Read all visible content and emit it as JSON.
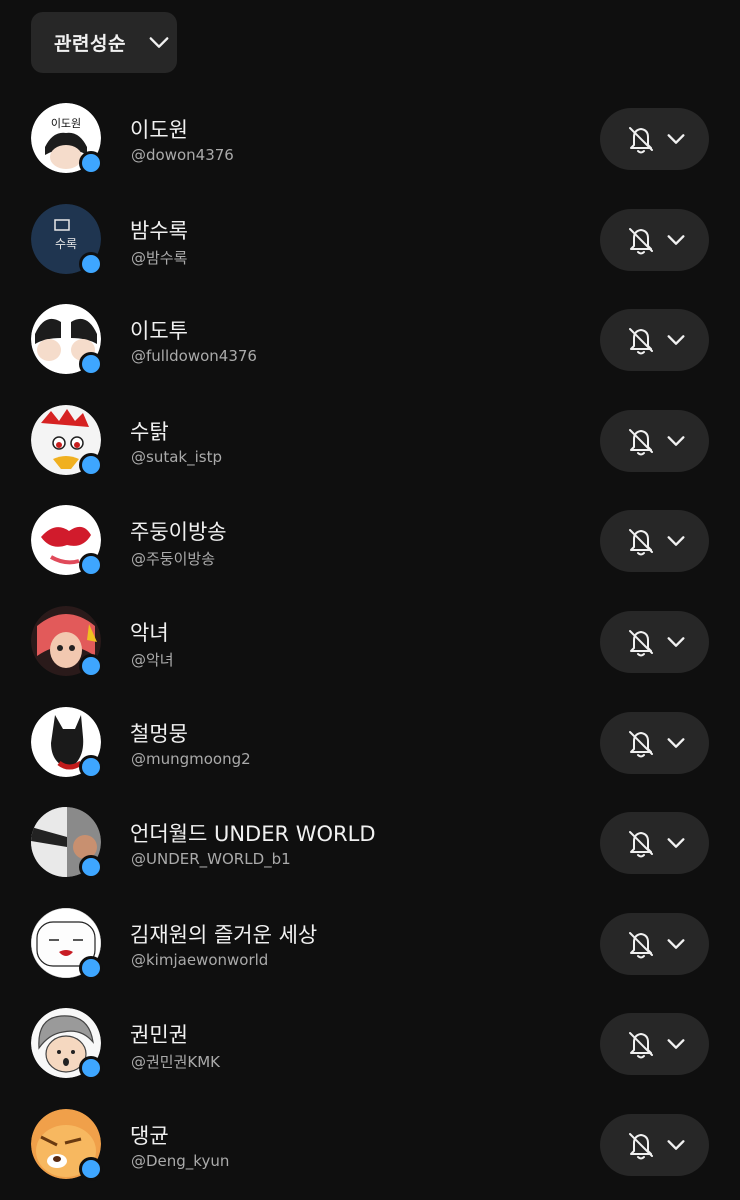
{
  "sort": {
    "label": "관련성순",
    "icon": "chevron-down-icon"
  },
  "subscriptions": [
    {
      "name": "이도원",
      "handle": "@dowon4376",
      "avatar_text": "이도원",
      "avatar_bg": "#ffffff",
      "avatar_fg": "#111111"
    },
    {
      "name": "밤수록",
      "handle": "@밤수록",
      "avatar_text": "수록",
      "avatar_bg": "#1f3550",
      "avatar_fg": "#e8e8e8"
    },
    {
      "name": "이도투",
      "handle": "@fulldowon4376",
      "avatar_text": "",
      "avatar_bg": "#ffffff",
      "avatar_fg": "#111111"
    },
    {
      "name": "수탉",
      "handle": "@sutak_istp",
      "avatar_text": "",
      "avatar_bg": "#f4f4f4",
      "avatar_fg": "#d02020"
    },
    {
      "name": "주둥이방송",
      "handle": "@주둥이방송",
      "avatar_text": "",
      "avatar_bg": "#ffffff",
      "avatar_fg": "#d11b2c"
    },
    {
      "name": "악녀",
      "handle": "@악녀",
      "avatar_text": "",
      "avatar_bg": "#2a1a1a",
      "avatar_fg": "#e25a5a"
    },
    {
      "name": "철멍뭉",
      "handle": "@mungmoong2",
      "avatar_text": "",
      "avatar_bg": "#ffffff",
      "avatar_fg": "#1a1a1a"
    },
    {
      "name": "언더월드 UNDER WORLD",
      "handle": "@UNDER_WORLD_b1",
      "avatar_text": "",
      "avatar_bg": "#8a8a8a",
      "avatar_fg": "#222222"
    },
    {
      "name": "김재원의 즐거운 세상",
      "handle": "@kimjaewonworld",
      "avatar_text": "",
      "avatar_bg": "#ffffff",
      "avatar_fg": "#c81d25"
    },
    {
      "name": "권민권",
      "handle": "@권민권KMK",
      "avatar_text": "",
      "avatar_bg": "#dcdcdc",
      "avatar_fg": "#333333"
    },
    {
      "name": "댕균",
      "handle": "@Deng_kyun",
      "avatar_text": "",
      "avatar_bg": "#f0a04a",
      "avatar_fg": "#ffffff"
    }
  ],
  "notification_icon": "bell-off-icon",
  "colors": {
    "background": "#0f0f0f",
    "button_bg": "#272727",
    "live_dot": "#3ea6ff",
    "handle_text": "#aaaaaa"
  }
}
